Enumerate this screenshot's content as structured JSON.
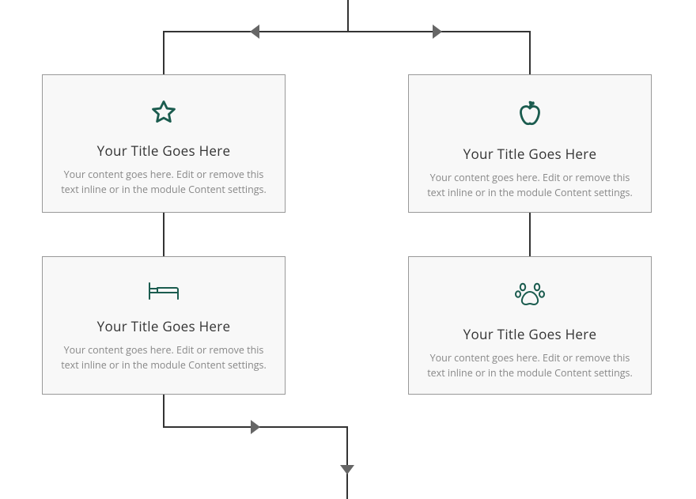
{
  "colors": {
    "icon": "#1b5c4f",
    "card_bg": "#f8f8f8",
    "card_border": "#999999",
    "line": "#333333",
    "arrow": "#666666",
    "title": "#333333",
    "body": "#888888"
  },
  "cards": [
    {
      "icon": "star-icon",
      "title": "Your Title Goes Here",
      "body": "Your content goes here. Edit or remove this text inline or in the module Content settings."
    },
    {
      "icon": "apple-icon",
      "title": "Your Title Goes Here",
      "body": "Your content goes here. Edit or remove this text inline or in the module Content settings."
    },
    {
      "icon": "bed-icon",
      "title": "Your Title Goes Here",
      "body": "Your content goes here. Edit or remove this text inline or in the module Content settings."
    },
    {
      "icon": "paw-icon",
      "title": "Your Title Goes Here",
      "body": "Your content goes here. Edit or remove this text inline or in the module Content settings."
    }
  ]
}
